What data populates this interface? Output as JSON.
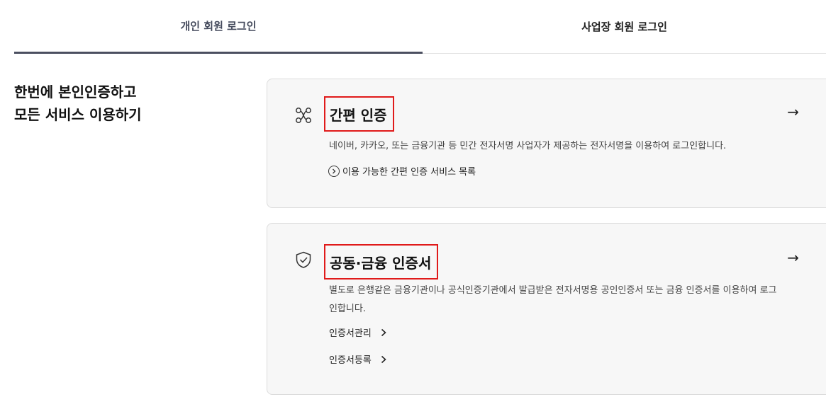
{
  "tabs": {
    "personal": "개인 회원 로그인",
    "business": "사업장 회원 로그인"
  },
  "headline": {
    "line1": "한번에 본인인증하고",
    "line2": "모든 서비스 이용하기"
  },
  "simple_auth": {
    "icon": "link-nodes-icon",
    "title": "간편 인증",
    "description": "네이버, 카카오, 또는 금융기관 등 민간 전자서명 사업자가 제공하는 전자서명을 이용하여 로그인합니다.",
    "service_list_link": "이용 가능한 간편 인증 서비스 목록",
    "arrow": "→"
  },
  "certificate_auth": {
    "icon": "shield-check-icon",
    "title": "공동·금융 인증서",
    "description": "별도로 은행같은 금융기관이나 공식인증기관에서 발급받은 전자서명용 공인인증서 또는 금융 인증서를 이용하여 로그인합니다.",
    "manage_link": "인증서관리",
    "register_link": "인증서등록",
    "arrow": "→"
  },
  "colors": {
    "highlight_border": "#e01a1a",
    "active_tab_underline": "#4b4f60",
    "card_background": "#f7f7f7"
  }
}
